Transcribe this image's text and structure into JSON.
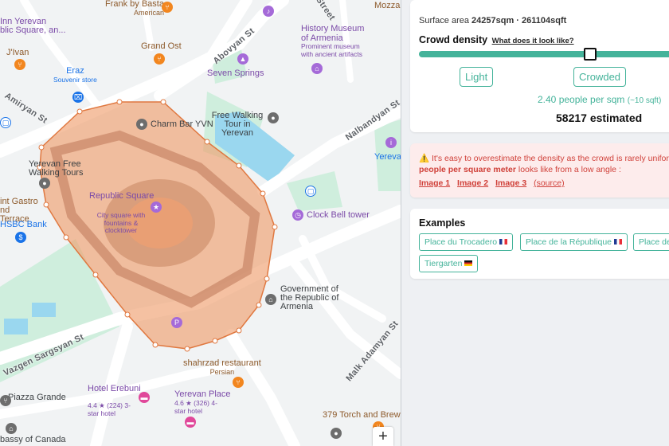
{
  "map": {
    "streets": [
      "Amiryan St",
      "Abovyan St",
      "Nalbandyan St",
      "Vazgen Sargsyan St",
      "Malk Adamyan St",
      "Street"
    ],
    "places": [
      {
        "name": "Frank by Basta",
        "sub": "American"
      },
      {
        "name": "Mozza",
        "sub": ""
      },
      {
        "name": "Inn Yerevan",
        "sub": "blic Square, an..."
      },
      {
        "name": "History Museum of Armenia",
        "sub": "Prominent museum with ancient artifacts"
      },
      {
        "name": "Grand Ost",
        "sub": ""
      },
      {
        "name": "J'Ivan",
        "sub": ""
      },
      {
        "name": "Eraz",
        "sub": "Souvenir store"
      },
      {
        "name": "Seven Springs",
        "sub": ""
      },
      {
        "name": "Charm Bar YVN",
        "sub": ""
      },
      {
        "name": "Free Walking Tour in Yerevan",
        "sub": ""
      },
      {
        "name": "Yerevan Free Walking Tours",
        "sub": ""
      },
      {
        "name": "Republic Square",
        "sub": "City square with fountains & clocktower"
      },
      {
        "name": "int Gastro nd Terrace",
        "sub": ""
      },
      {
        "name": "Clock Bell tower",
        "sub": ""
      },
      {
        "name": "HSBC Bank",
        "sub": ""
      },
      {
        "name": "Government of the Republic of Armenia",
        "sub": ""
      },
      {
        "name": "shahrzad restaurant",
        "sub": "Persian"
      },
      {
        "name": "Hotel Erebuni",
        "sub": "4.4 ★ (224)  3-star hotel"
      },
      {
        "name": "Piazza Grande",
        "sub": ""
      },
      {
        "name": "Yerevan Place",
        "sub": "4.6 ★ (326)  4-star hotel"
      },
      {
        "name": "379 Torch and Brew",
        "sub": ""
      },
      {
        "name": "bassy of Canada",
        "sub": ""
      },
      {
        "name": "Yerevan Inform",
        "sub": ""
      }
    ],
    "zoom_in": "+"
  },
  "density": {
    "surface_label": "Surface area",
    "surface_value": "24257sqm · 261104sqft",
    "title": "Crowd density",
    "help_link": "What does it look like?",
    "slider_value": 0.66,
    "light_label": "Light",
    "crowded_label": "Crowded",
    "people_per_sqm": "2.40 people per sqm",
    "per_sqft": "(~10 sqft)",
    "estimate": "58217 estimated"
  },
  "warning": {
    "line1": "⚠️ It's easy to overestimate the density as the crowd is rarely uniform",
    "line2_bold": "people per square meter",
    "line2_rest": " looks like from a low angle :",
    "links": [
      "Image 1",
      "Image 2",
      "Image 3"
    ],
    "source": "(source)"
  },
  "examples": {
    "title": "Examples",
    "items": [
      {
        "label": "Place du Trocadero",
        "flag": "fr"
      },
      {
        "label": "Place de la République",
        "flag": "fr"
      },
      {
        "label": "Place de",
        "flag": ""
      },
      {
        "label": "Tiergarten",
        "flag": "de"
      }
    ]
  },
  "colors": {
    "accent": "#44b39a",
    "warning": "#d0413a",
    "polygon": "#f0a070"
  }
}
